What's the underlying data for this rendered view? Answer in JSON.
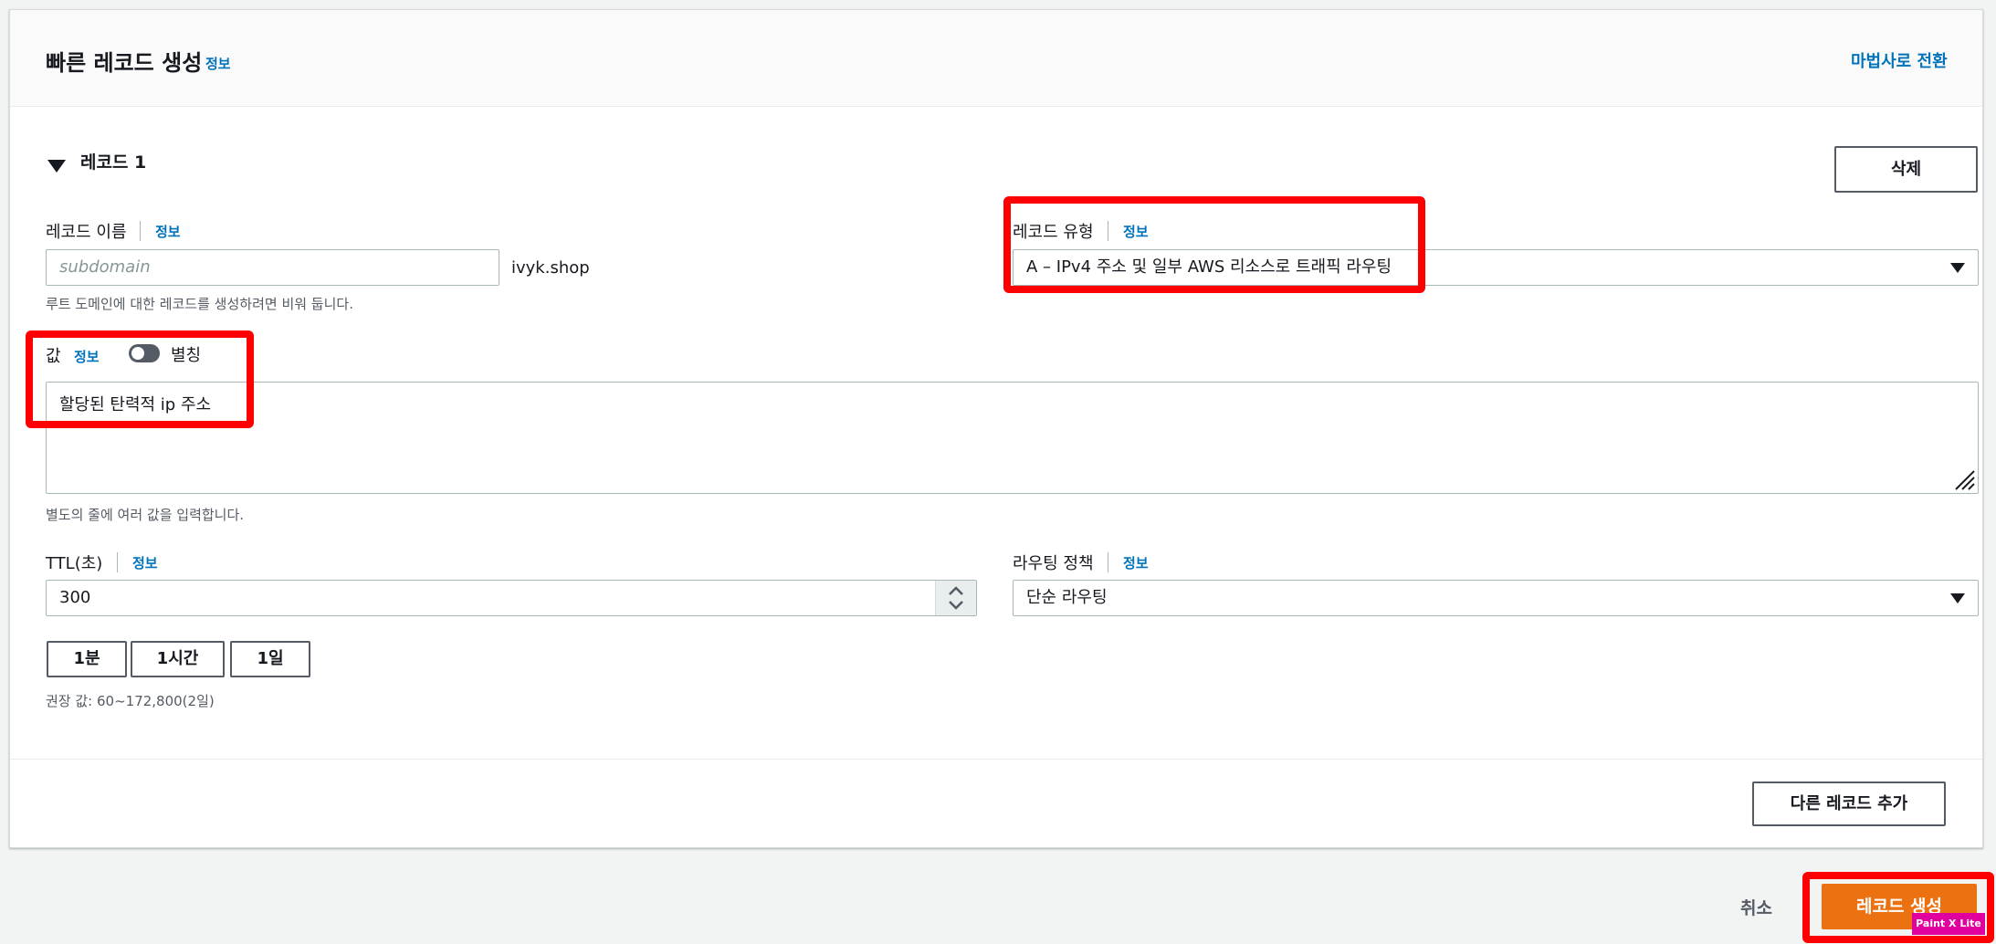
{
  "header": {
    "title": "빠른 레코드 생성",
    "info": "정보",
    "wizard_link": "마법사로 전환"
  },
  "record": {
    "section_title": "레코드 1",
    "delete_label": "삭제",
    "name": {
      "label": "레코드 이름",
      "info": "정보",
      "placeholder": "subdomain",
      "domain_suffix": "ivyk.shop",
      "hint": "루트 도메인에 대한 레코드를 생성하려면 비워 둡니다."
    },
    "type": {
      "label": "레코드 유형",
      "info": "정보",
      "selected": "A – IPv4 주소 및 일부 AWS 리소스로 트래픽 라우팅"
    },
    "value": {
      "label": "값",
      "info": "정보",
      "alias_label": "별칭",
      "alias_enabled": false,
      "text": "할당된 탄력적 ip 주소",
      "hint": "별도의 줄에 여러 값을 입력합니다."
    },
    "ttl": {
      "label": "TTL(초)",
      "info": "정보",
      "value": "300",
      "presets": [
        "1분",
        "1시간",
        "1일"
      ],
      "hint": "권장 값: 60~172,800(2일)"
    },
    "routing": {
      "label": "라우팅 정책",
      "info": "정보",
      "selected": "단순 라우팅"
    }
  },
  "add_record_label": "다른 레코드 추가",
  "footer": {
    "cancel_label": "취소",
    "create_label": "레코드 생성",
    "watermark": "Paint X Lite"
  },
  "colors": {
    "accent": "#0073bb",
    "primary_button": "#ec7211",
    "highlight": "#ff0000"
  }
}
